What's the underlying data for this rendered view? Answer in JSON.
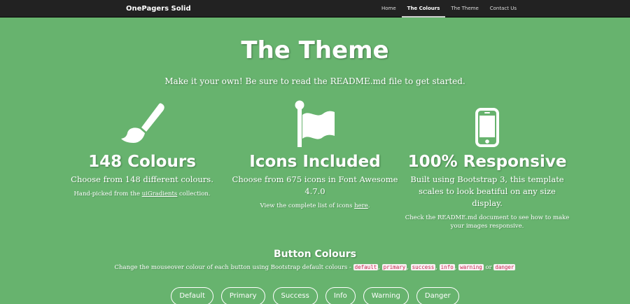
{
  "navbar": {
    "brand": "OnePagers Solid",
    "items": [
      {
        "label": "Home"
      },
      {
        "label": "The Colours"
      },
      {
        "label": "The Theme"
      },
      {
        "label": "Contact Us"
      }
    ]
  },
  "hero": {
    "title": "The Theme",
    "subtitle": "Make it your own! Be sure to read the README.md file to get started."
  },
  "features": [
    {
      "icon": "paint-brush-icon",
      "title": "148 Colours",
      "lead": "Choose from 148 different colours.",
      "note_before": "Hand-picked from the ",
      "note_link": "uiGradients",
      "note_after": " collection."
    },
    {
      "icon": "flag-icon",
      "title": "Icons Included",
      "lead": "Choose from 675 icons in Font Awesome 4.7.0",
      "note_before": "View the complete list of icons ",
      "note_link": "here",
      "note_after": "."
    },
    {
      "icon": "mobile-phone-icon",
      "title": "100% Responsive",
      "lead": "Built using Bootstrap 3, this template scales to look beatiful on any size display.",
      "note": "Check the README.md document to see how to make your images responsive."
    }
  ],
  "buttons_section": {
    "heading": "Button Colours",
    "desc_before": "Change the mouseover colour of each button using Bootstrap default colours - ",
    "codes": [
      "default",
      "primary",
      "success",
      "info",
      "warning",
      "danger"
    ],
    "sep": ", ",
    "or": " or ",
    "buttons": [
      "Default",
      "Primary",
      "Success",
      "Info",
      "Warning",
      "Danger"
    ]
  },
  "colors": {
    "background": "#67b36e",
    "navbar": "#222222",
    "code_text": "#c7254e",
    "code_bg": "#f9f2f4"
  }
}
